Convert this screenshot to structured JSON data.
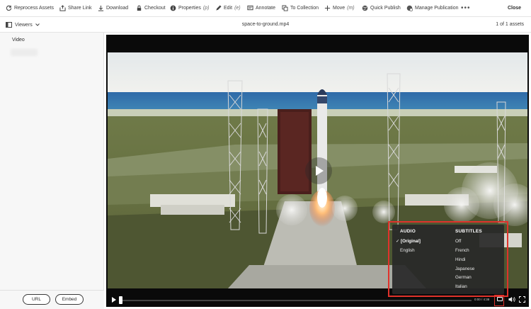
{
  "toolbar": {
    "items": [
      {
        "label": "Reprocess Assets",
        "icon": "refresh-icon"
      },
      {
        "label": "Share Link",
        "icon": "share-icon"
      },
      {
        "label": "Download",
        "icon": "download-icon"
      },
      {
        "label": "Checkout",
        "icon": "lock-icon"
      },
      {
        "label": "Properties",
        "shortcut": "(p)",
        "icon": "info-icon"
      },
      {
        "label": "Edit",
        "shortcut": "(e)",
        "icon": "pencil-icon"
      },
      {
        "label": "Annotate",
        "icon": "annotate-icon"
      },
      {
        "label": "To Collection",
        "icon": "collection-icon"
      },
      {
        "label": "Move",
        "shortcut": "(m)",
        "icon": "move-icon"
      },
      {
        "label": "Quick Publish",
        "icon": "globe-icon"
      },
      {
        "label": "Manage Publication",
        "icon": "publication-icon"
      }
    ],
    "more": "•••",
    "close": "Close"
  },
  "subbar": {
    "viewers": "Viewers",
    "file_title": "space-to-ground.mp4",
    "asset_count": "1 of 1 assets"
  },
  "left_panel": {
    "section_label": "Video",
    "url_button": "URL",
    "embed_button": "Embed"
  },
  "player": {
    "time": "0:00 / 4:38",
    "menu": {
      "audio_heading": "AUDIO",
      "audio_options": [
        {
          "label": "[Original]",
          "selected": true,
          "check": "✓"
        },
        {
          "label": "English",
          "selected": false
        }
      ],
      "subtitles_heading": "SUBTITLES",
      "subtitle_options": [
        "Off",
        "French",
        "Hindi",
        "Japanese",
        "German",
        "Italian"
      ]
    }
  },
  "colors": {
    "highlight": "#e0322b",
    "menu_bg": "#282828"
  }
}
